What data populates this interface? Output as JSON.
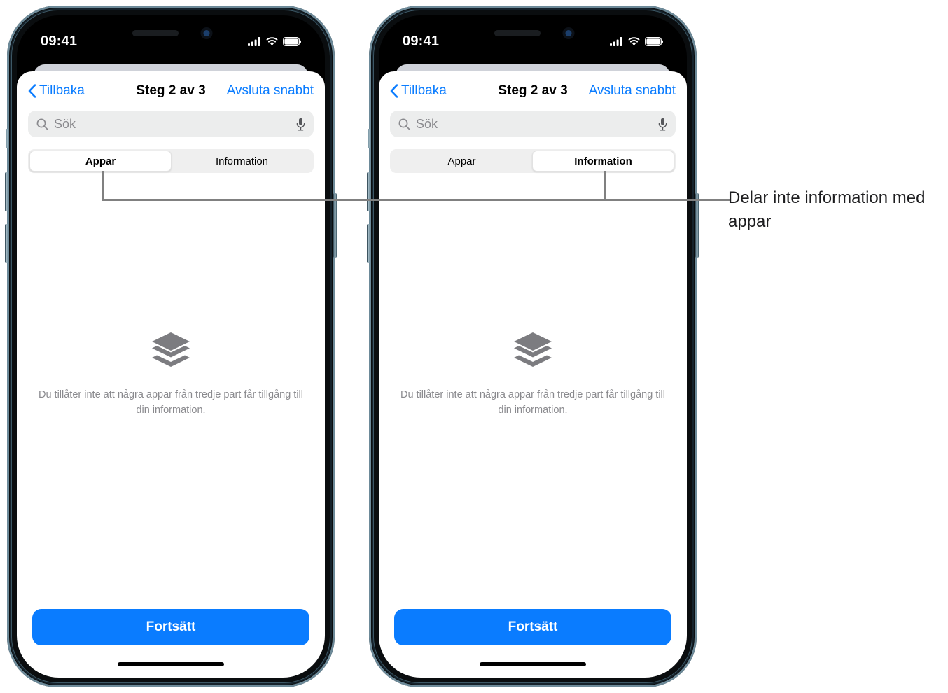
{
  "phones": [
    {
      "id": "left",
      "status_bar": {
        "time": "09:41",
        "cellular_icon": "cellular-bars-icon",
        "wifi_icon": "wifi-icon",
        "battery_icon": "battery-icon"
      },
      "navbar": {
        "back_label": "Tillbaka",
        "title": "Steg 2 av 3",
        "action_label": "Avsluta snabbt"
      },
      "search": {
        "placeholder": "Sök",
        "value": "",
        "search_icon": "search-icon",
        "mic_icon": "microphone-icon"
      },
      "segmented": {
        "options": [
          "Appar",
          "Information"
        ],
        "selected_index": 0
      },
      "empty_state": {
        "icon": "stack-layers-icon",
        "description": "Du tillåter inte att några appar från tredje part får tillgång till din information."
      },
      "cta_label": "Fortsätt"
    },
    {
      "id": "right",
      "status_bar": {
        "time": "09:41",
        "cellular_icon": "cellular-bars-icon",
        "wifi_icon": "wifi-icon",
        "battery_icon": "battery-icon"
      },
      "navbar": {
        "back_label": "Tillbaka",
        "title": "Steg 2 av 3",
        "action_label": "Avsluta snabbt"
      },
      "search": {
        "placeholder": "Sök",
        "value": "",
        "search_icon": "search-icon",
        "mic_icon": "microphone-icon"
      },
      "segmented": {
        "options": [
          "Appar",
          "Information"
        ],
        "selected_index": 1
      },
      "empty_state": {
        "icon": "stack-layers-icon",
        "description": "Du tillåter inte att några appar från tredje part får tillgång till din information."
      },
      "cta_label": "Fortsätt"
    }
  ],
  "callout": {
    "text": "Delar inte information med appar"
  },
  "colors": {
    "accent_blue": "#0a7cff",
    "segmented_track": "#efefef",
    "search_field": "#eceded",
    "muted_text": "#8a8a8e",
    "callout_line": "#808080",
    "sheet_back": "#cfd2d9"
  }
}
